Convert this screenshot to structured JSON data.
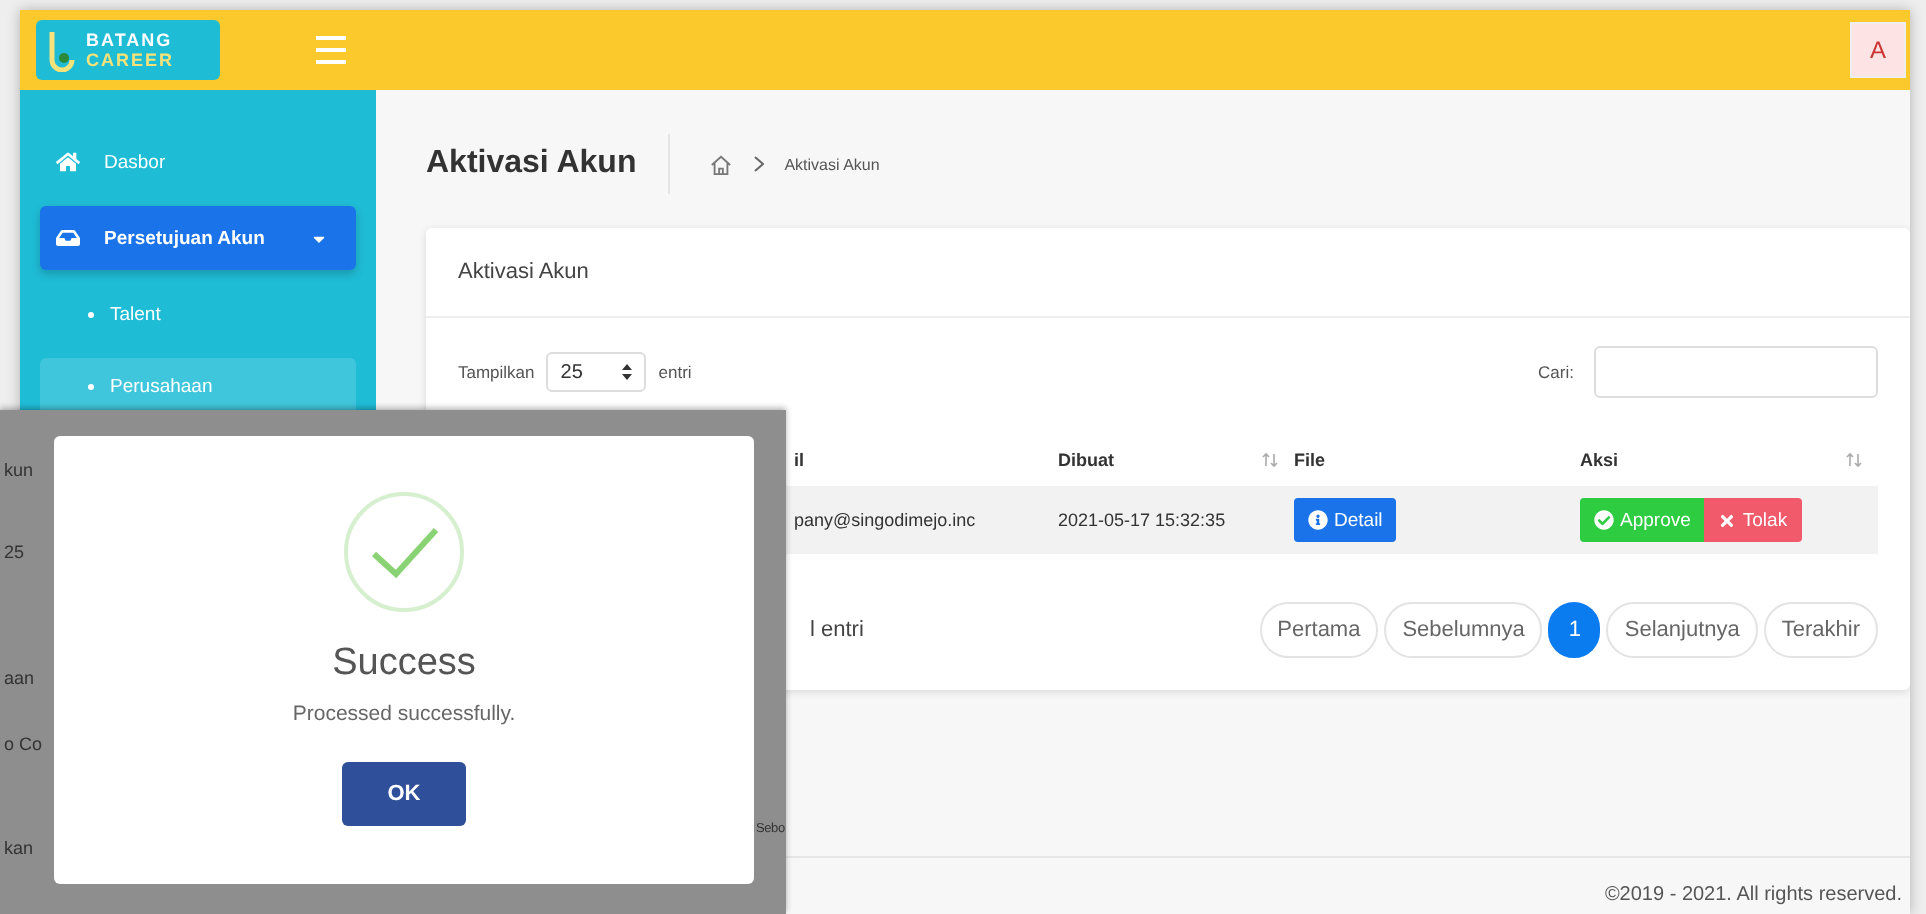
{
  "brand": {
    "line1": "BATANG",
    "line2": "CAREER"
  },
  "user": {
    "initial": "A"
  },
  "sidebar": {
    "items": [
      {
        "label": "Dasbor",
        "kind": "link",
        "selected": false
      },
      {
        "label": "Persetujuan Akun",
        "kind": "group",
        "selected": true,
        "expanded": true,
        "children": [
          {
            "label": "Talent",
            "selected": false
          },
          {
            "label": "Perusahaan",
            "selected": true
          }
        ]
      }
    ]
  },
  "page": {
    "title": "Aktivasi Akun",
    "breadcrumb": [
      "Aktivasi Akun"
    ]
  },
  "card": {
    "title": "Aktivasi Akun",
    "length_label": "Tampilkan",
    "length_value": "25",
    "length_suffix": "entri",
    "search_label": "Cari:",
    "table": {
      "columns": [
        {
          "label": "il",
          "sortable": false
        },
        {
          "label": "Dibuat",
          "sortable": true
        },
        {
          "label": "File",
          "sortable": false
        },
        {
          "label": "Aksi",
          "sortable": true
        }
      ],
      "rows": [
        {
          "email": "pany@singodimejo.inc",
          "created": "2021-05-17 15:32:35",
          "file_button": "Detail",
          "approve": "Approve",
          "reject": "Tolak"
        }
      ]
    },
    "info": "l entri",
    "pagination": [
      {
        "label": "Pertama",
        "selected": false
      },
      {
        "label": "Sebelumnya",
        "selected": false
      },
      {
        "label": "1",
        "selected": true
      },
      {
        "label": "Selanjutnya",
        "selected": false
      },
      {
        "label": "Terakhir",
        "selected": false
      }
    ]
  },
  "footer": "©2019 - 2021. All rights reserved.",
  "inset": {
    "fragments": [
      "kun",
      "25",
      "aan",
      "o Co",
      "kan",
      "Sebo"
    ],
    "dialog": {
      "title": "Success",
      "message": "Processed successfully.",
      "button": "OK"
    }
  }
}
